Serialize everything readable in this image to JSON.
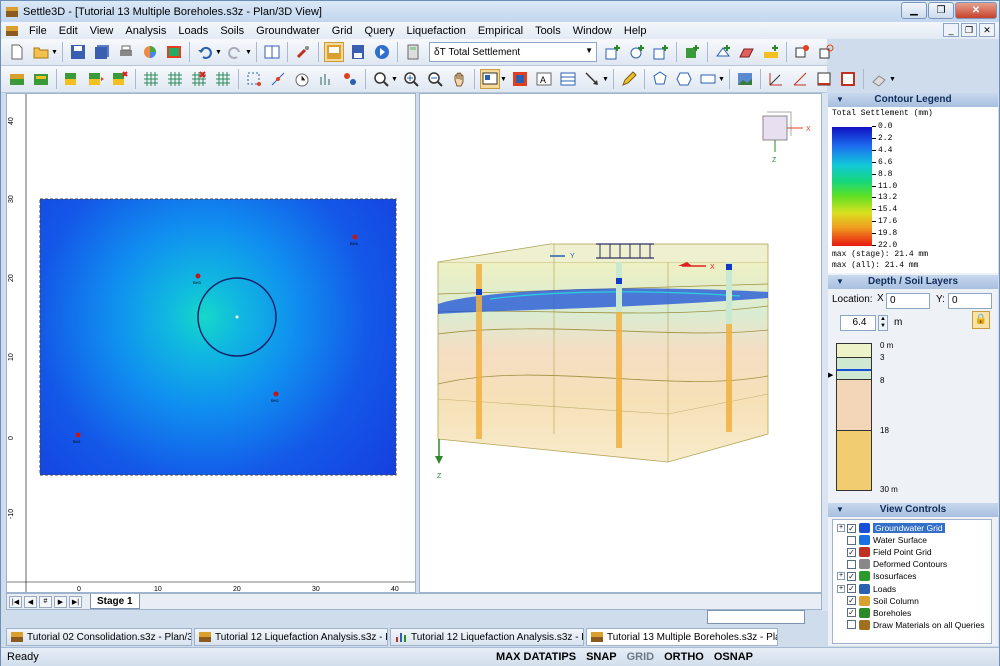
{
  "window": {
    "title": "Settle3D - [Tutorial 13 Multiple Boreholes.s3z - Plan/3D View]"
  },
  "menu": [
    "File",
    "Edit",
    "View",
    "Analysis",
    "Loads",
    "Soils",
    "Groundwater",
    "Grid",
    "Query",
    "Liquefaction",
    "Empirical",
    "Tools",
    "Window",
    "Help"
  ],
  "toolbar": {
    "query_value": "Total Settlement",
    "query_symbol": "δT"
  },
  "plan": {
    "x_ticks": [
      "0",
      "10",
      "20",
      "30",
      "40"
    ],
    "y_ticks": [
      "40",
      "30",
      "20",
      "10",
      "0",
      "-10"
    ],
    "boreholes": [
      {
        "label": "BH1"
      },
      {
        "label": "BH2"
      },
      {
        "label": "BH3"
      },
      {
        "label": "BH4"
      }
    ]
  },
  "axes3d": {
    "x": "X",
    "y": "Y",
    "z": "Z"
  },
  "stage_tab": "Stage 1",
  "doc_tabs": [
    {
      "label": "Tutorial 02 Consolidation.s3z - Plan/3D View",
      "active": false
    },
    {
      "label": "Tutorial 12 Liquefaction Analysis.s3z - Plan/3D ...",
      "active": false
    },
    {
      "label": "Tutorial 12 Liquefaction Analysis.s3z - Liquefacti...",
      "active": false
    },
    {
      "label": "Tutorial 13 Multiple Boreholes.s3z - Plan/3D Vie...",
      "active": true
    }
  ],
  "status": {
    "ready": "Ready",
    "buttons": [
      "MAX DATATIPS",
      "SNAP",
      "GRID",
      "ORTHO",
      "OSNAP"
    ]
  },
  "contour_legend": {
    "header": "Contour Legend",
    "title": "Total Settlement (mm)",
    "values": [
      "0.0",
      "2.2",
      "4.4",
      "6.6",
      "8.8",
      "11.0",
      "13.2",
      "15.4",
      "17.6",
      "19.8",
      "22.0"
    ],
    "max_stage": "max (stage): 21.4 mm",
    "max_all": "max (all):   21.4 mm",
    "colors": [
      "#1010c0",
      "#1d6cf0",
      "#12c8d8",
      "#16d87a",
      "#5ee024",
      "#d8e020",
      "#f0a020",
      "#e81810"
    ]
  },
  "depth_layers": {
    "header": "Depth / Soil Layers",
    "location_label": "Location:",
    "x_label": "X",
    "y_label": "Y:",
    "x_value": "0",
    "y_value": "0",
    "depth_value": "6.4",
    "depth_unit": "m",
    "ticks": [
      "0 m",
      "3",
      "8",
      "18",
      "30 m"
    ]
  },
  "view_controls": {
    "header": "View Controls",
    "items": [
      {
        "label": "Groundwater Grid",
        "checked": true,
        "expandable": true,
        "selected": true
      },
      {
        "label": "Water Surface",
        "checked": false,
        "expandable": false,
        "selected": false
      },
      {
        "label": "Field Point Grid",
        "checked": true,
        "expandable": false,
        "selected": false
      },
      {
        "label": "Deformed Contours",
        "checked": false,
        "expandable": false,
        "selected": false
      },
      {
        "label": "Isosurfaces",
        "checked": true,
        "expandable": true,
        "selected": false
      },
      {
        "label": "Loads",
        "checked": true,
        "expandable": true,
        "selected": false
      },
      {
        "label": "Soil Column",
        "checked": true,
        "expandable": false,
        "selected": false
      },
      {
        "label": "Boreholes",
        "checked": true,
        "expandable": false,
        "selected": false
      },
      {
        "label": "Draw Materials on all Queries",
        "checked": false,
        "expandable": false,
        "selected": false
      }
    ]
  }
}
